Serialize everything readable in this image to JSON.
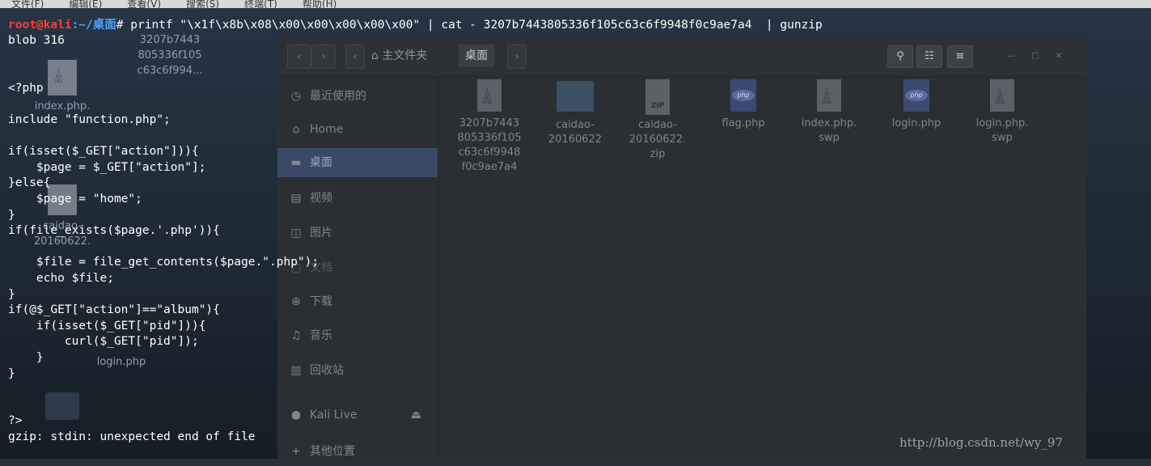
{
  "menubar": [
    "文件(F)",
    "编辑(E)",
    "查看(V)",
    "搜索(S)",
    "终端(T)",
    "帮助(H)"
  ],
  "terminal": {
    "prompt_user": "root@kali",
    "prompt_path": ":~/桌面",
    "prompt_hash": "# ",
    "command": "printf \"\\x1f\\x8b\\x08\\x00\\x00\\x00\\x00\\x00\" | cat - 3207b7443805336f105c63c6f9948f0c9ae7a4  | gunzip",
    "output_lines": [
      "blob 316",
      "",
      "",
      "<?php",
      "",
      "include \"function.php\";",
      "",
      "if(isset($_GET[\"action\"])){",
      "    $page = $_GET[\"action\"];",
      "}else{",
      "    $page = \"home\";",
      "}",
      "if(file_exists($page.'.php')){",
      "",
      "    $file = file_get_contents($page.\".php\");",
      "    echo $file;",
      "}",
      "if(@$_GET[\"action\"]==\"album\"){",
      "    if(isset($_GET[\"pid\"])){",
      "        curl($_GET[\"pid\"]);",
      "    }",
      "}",
      "",
      "",
      "?>",
      "gzip: stdin: unexpected end of file"
    ]
  },
  "desktop_icons": [
    {
      "label": "3207b7443\n805336f105\nc63c6f994..."
    },
    {
      "label": "index.php."
    },
    {
      "label": "caidao-\n20160622."
    },
    {
      "label": "login.php"
    }
  ],
  "file_manager": {
    "breadcrumb": [
      "主文件夹",
      "桌面"
    ],
    "sidebar": [
      {
        "label": "最近使用的",
        "icon": "clock-icon"
      },
      {
        "label": "Home",
        "icon": "home-icon"
      },
      {
        "label": "桌面",
        "icon": "folder-icon",
        "active": true
      },
      {
        "label": "视频",
        "icon": "video-icon"
      },
      {
        "label": "图片",
        "icon": "image-icon"
      },
      {
        "label": "文档",
        "icon": "document-icon"
      },
      {
        "label": "下载",
        "icon": "download-icon"
      },
      {
        "label": "音乐",
        "icon": "music-icon"
      },
      {
        "label": "回收站",
        "icon": "trash-icon"
      },
      {
        "label": "Kali Live",
        "icon": "disc-icon"
      },
      {
        "label": "其他位置",
        "icon": "plus-icon"
      }
    ],
    "files": [
      {
        "name": "3207b7443\n805336f105\nc63c6f9948\nf0c9ae7a4",
        "type": "doc"
      },
      {
        "name": "caidao-\n20160622",
        "type": "folder"
      },
      {
        "name": "caidao-\n20160622.\nzip",
        "type": "zip"
      },
      {
        "name": "flag.php",
        "type": "php"
      },
      {
        "name": "index.php.\nswp",
        "type": "doc"
      },
      {
        "name": "login.php",
        "type": "php"
      },
      {
        "name": "login.php.\nswp",
        "type": "doc"
      }
    ]
  },
  "watermark": "http://blog.csdn.net/wy_97"
}
